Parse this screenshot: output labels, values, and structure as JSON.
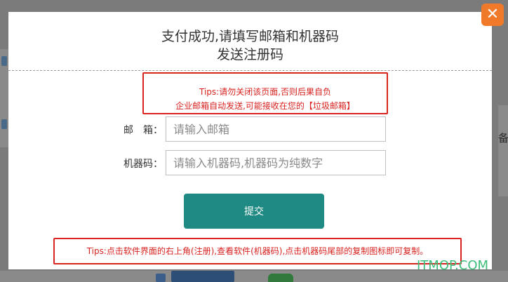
{
  "dialog": {
    "title_line1": "支付成功,请填写邮箱和机器码",
    "title_line2": "发送注册码",
    "close_symbol": "✕"
  },
  "tips": {
    "line1": "Tips:请勿关闭该页面,否则后果自负",
    "line2": "企业邮箱自动发送,可能接收在您的【垃圾邮箱】"
  },
  "form": {
    "email_label": "邮　箱：",
    "email_placeholder": "请输入邮箱",
    "email_value": "",
    "machine_label": "机器码：",
    "machine_placeholder": "请输入机器码,机器码为纯数字",
    "machine_value": "",
    "submit_label": "提交"
  },
  "bottom_tips": "Tips:点击软件界面的右上角(注册),查看软件(机器码),点击机器码尾部的复制图标即可复制。",
  "background": {
    "right_text": "备注"
  },
  "watermark": "ITMOP.COM",
  "colors": {
    "accent": "#1f8a83",
    "close": "#f07a2a",
    "warning": "#d8231f"
  }
}
